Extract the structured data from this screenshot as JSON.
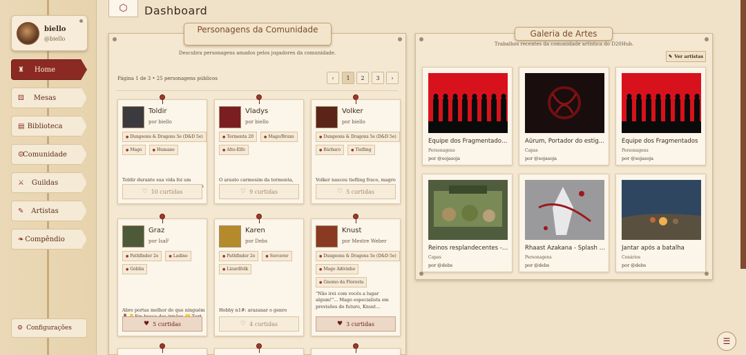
{
  "user": {
    "name": "biello",
    "handle": "@biello"
  },
  "nav": [
    {
      "label": "Home",
      "icon": "castle-icon",
      "glyph": "♜"
    },
    {
      "label": "Mesas",
      "icon": "dice-icon",
      "glyph": "⚄"
    },
    {
      "label": "Biblioteca",
      "icon": "book-icon",
      "glyph": "▤"
    },
    {
      "label": "Comunidade",
      "icon": "people-icon",
      "glyph": "☺"
    },
    {
      "label": "Guildas",
      "icon": "swords-icon",
      "glyph": "⚔"
    },
    {
      "label": "Artistas",
      "icon": "brush-icon",
      "glyph": "✎"
    },
    {
      "label": "Compêndio",
      "icon": "scroll-icon",
      "glyph": "❧"
    }
  ],
  "settings_label": "Configurações",
  "page_title": "Dashboard",
  "characters": {
    "title": "Personagens da Comunidade",
    "subtitle": "Descubra personagens amados pelos jogadores da comunidade.",
    "page_info": "Página 1 de 3 • 25 personagens públicos",
    "pages": [
      "1",
      "2",
      "3"
    ],
    "prev": "‹",
    "next": "›",
    "cards": [
      {
        "name": "Toldir",
        "by": "por biello",
        "tags": [
          "Dungeons & Dragons 5e (D&D 5e)",
          "Mago",
          "Humano"
        ],
        "desc": "Toldir durante sua vida foi um homem focado em estudos, dedicou sua vida a isso, toda...",
        "likes": "10 curtidas",
        "liked": false,
        "port": "#3b3a3e"
      },
      {
        "name": "Vladys",
        "by": "por biello",
        "tags": [
          "Tormenta 20",
          "Mago/Bruxo",
          "Alto-Elfo"
        ],
        "desc": "O arauto carmesim da tormenta, encarregado de trazer a peste rubra ao mundo através de...",
        "likes": "9 curtidas",
        "liked": false,
        "port": "#7a1e22"
      },
      {
        "name": "Volker",
        "by": "por biello",
        "tags": [
          "Dungeons & Dragons 5e (D&D 5e)",
          "Bárbaro",
          "Tiefling"
        ],
        "desc": "Volker nasceu tiefling fraco, magro e rejeitado. Cresceu sendo tratado como algo...",
        "likes": "5 curtidas",
        "liked": false,
        "port": "#5a2418"
      },
      {
        "name": "Graz",
        "by": "por IsaF",
        "tags": [
          "Pathfinder 2e",
          "Ladino",
          "Goblin"
        ],
        "desc": "Abre portas melhor do que ninguém 🚪🔑 Em busca dos irmãos 💛 Turt & Chox 💜...",
        "likes": "5 curtidas",
        "liked": true,
        "port": "#4d5a3a"
      },
      {
        "name": "Karen",
        "by": "por Debs",
        "tags": [
          "Pathfinder 2e",
          "Sorcerer",
          "Lizardfolk"
        ],
        "desc": "Hobby n1#: arazanar o genro",
        "likes": "4 curtidas",
        "liked": false,
        "port": "#b58a2c"
      },
      {
        "name": "Knust",
        "by": "por Mestre Weber",
        "tags": [
          "Dungeons & Dragons 5e (D&D 5e)",
          "Mago Adivinho",
          "Gnomo da Floresta"
        ],
        "desc": "\"Não irei com vocês a lugar algum!\"... Mago especialista em previsões do futuro, Knust...",
        "likes": "3 curtidas",
        "liked": true,
        "port": "#8a3a22"
      }
    ]
  },
  "gallery": {
    "title": "Galeria de Artes",
    "subtitle": "Trabalhos recentes da comunidade artística do D20Hub.",
    "button": "Ver artistas",
    "items": [
      {
        "title": "Equipe dos Fragmentados (...",
        "category": "Personagens",
        "author": "por @sojasoja",
        "bg": "#d8121c"
      },
      {
        "title": "Aûrum, Portador do estig...",
        "category": "Capas",
        "author": "por @sojasoja",
        "bg": "#1a0d0d"
      },
      {
        "title": "Equipe dos Fragmentados",
        "category": "Personagens",
        "author": "por @sojasoja",
        "bg": "#d8121c"
      },
      {
        "title": "Reinos resplandecentes - c...",
        "category": "Capas",
        "author": "por @debs",
        "bg": "#5f6a4a"
      },
      {
        "title": "Rhaast Azakana - Splash Art",
        "category": "Personagens",
        "author": "por @debs",
        "bg": "#8a8c90"
      },
      {
        "title": "Jantar após a batalha",
        "category": "Cenários",
        "author": "por @debs",
        "bg": "#3d5872"
      }
    ]
  }
}
